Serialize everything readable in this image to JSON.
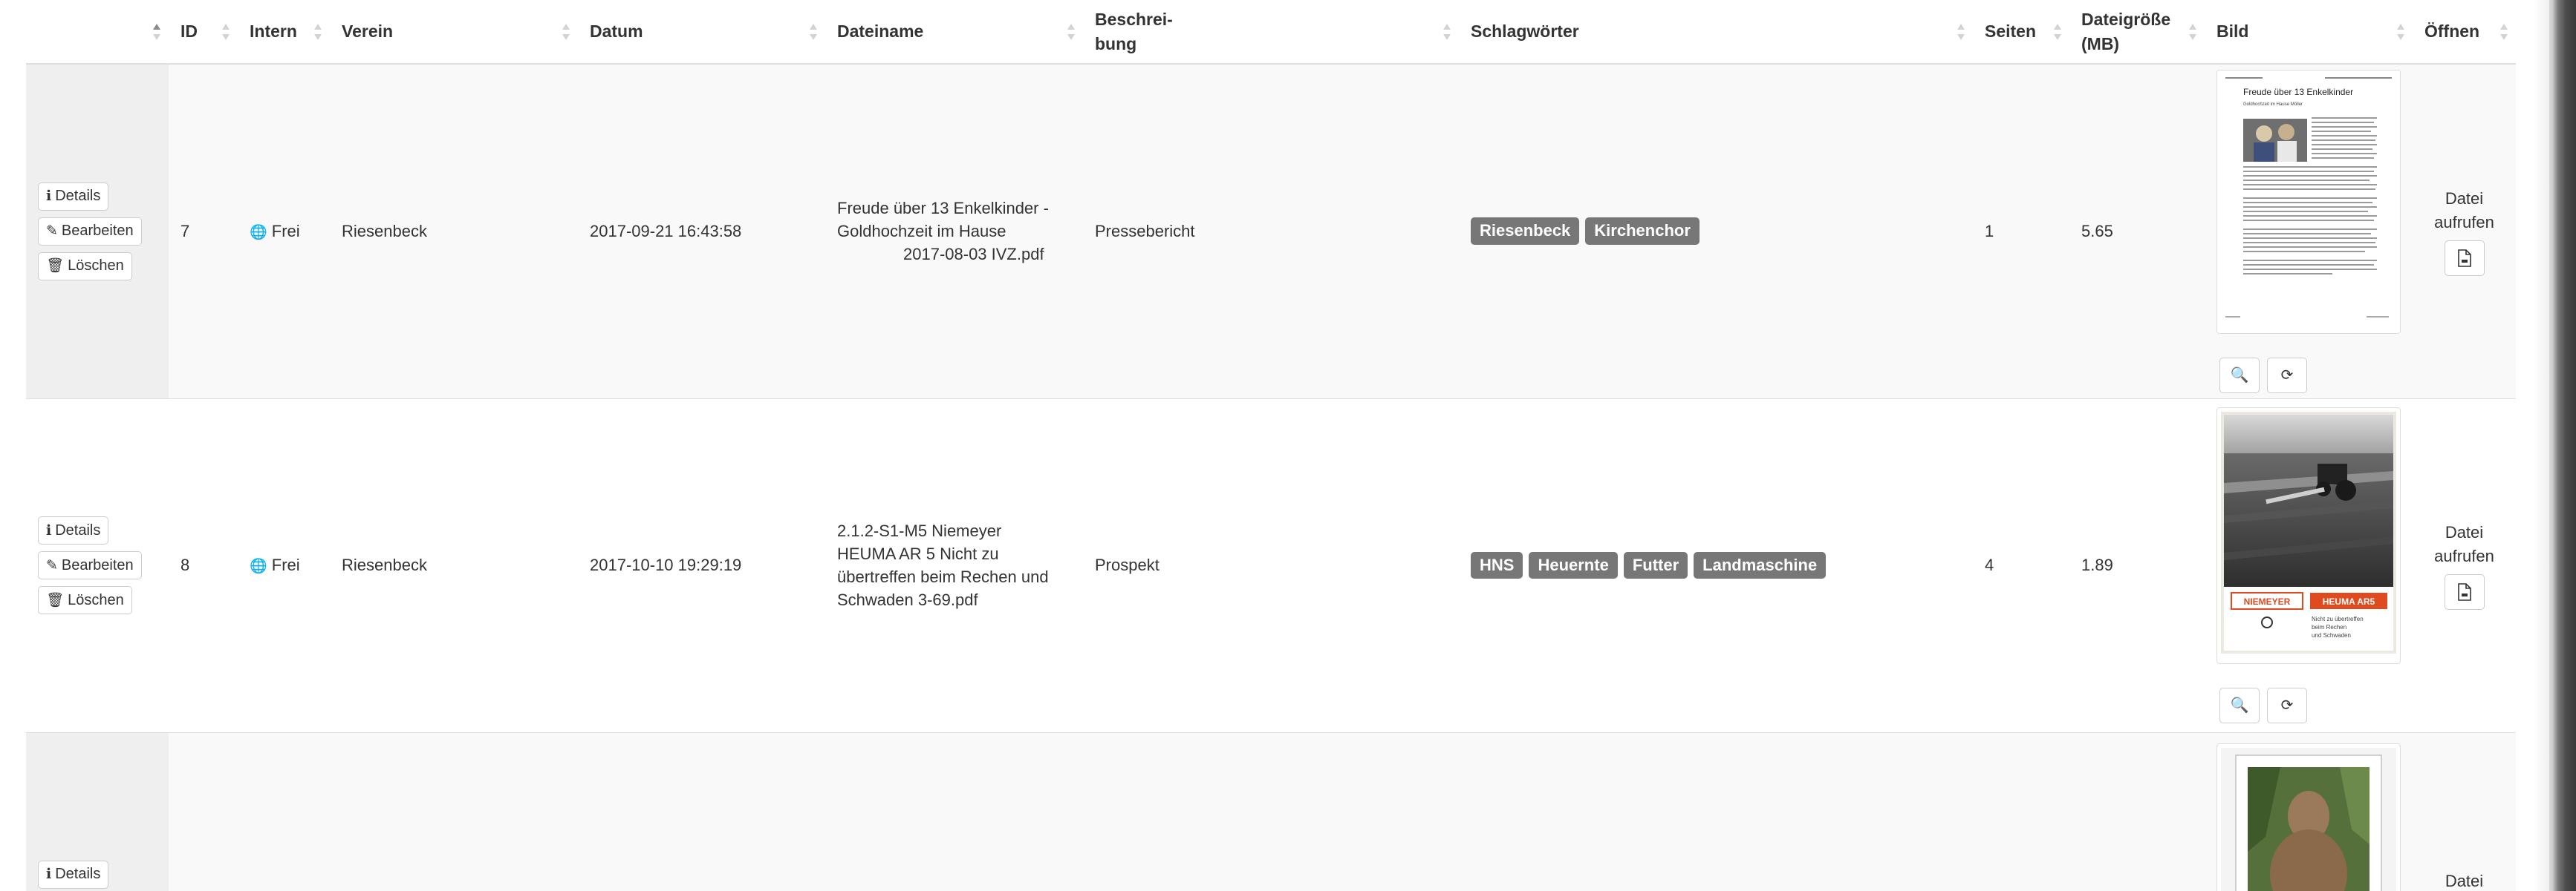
{
  "columns": {
    "id": "ID",
    "intern": "Intern",
    "verein": "Verein",
    "datum": "Datum",
    "dateiname": "Dateiname",
    "beschreibung_1": "Beschrei-",
    "beschreibung_2": "bung",
    "schlagwoerter": "Schlagwörter",
    "seiten": "Seiten",
    "dateigroesse_1": "Dateigröße",
    "dateigroesse_2": "(MB)",
    "bild": "Bild",
    "oeffnen": "Öffnen"
  },
  "actions": {
    "details": "Details",
    "edit": "Bearbeiten",
    "delete": "Löschen",
    "open_1": "Datei",
    "open_2": "aufrufen"
  },
  "rows": [
    {
      "id": "7",
      "intern": "Frei",
      "verein": "Riesenbeck",
      "datum": "2017-09-21 16:43:58",
      "filename_1": "Freude über 13 Enkelkinder -",
      "filename_2": "Goldhochzeit im Hause",
      "filename_3": "2017-08-03 IVZ.pdf",
      "beschreibung": "Pressebericht",
      "tags": [
        "Riesenbeck",
        "Kirchenchor"
      ],
      "seiten": "1",
      "groesse": "5.65",
      "thumb_title": "Freude über 13 Enkelkinder",
      "thumb_sub": "Goldhochzeit im Hause Möller"
    },
    {
      "id": "8",
      "intern": "Frei",
      "verein": "Riesenbeck",
      "datum": "2017-10-10 19:29:19",
      "filename_1": "2.1.2-S1-M5 Niemeyer",
      "filename_2": "HEUMA AR 5 Nicht zu",
      "filename_3": "übertreffen beim Rechen und",
      "filename_4": "Schwaden 3-69.pdf",
      "beschreibung": "Prospekt",
      "tags": [
        "HNS",
        "Heuernte",
        "Futter",
        "Landmaschine"
      ],
      "seiten": "4",
      "groesse": "1.89",
      "thumb_brand": "NIEMEYER",
      "thumb_model": "HEUMA AR5",
      "thumb_caption_1": "Nicht zu übertreffen",
      "thumb_caption_2": "beim Rechen",
      "thumb_caption_3": "und Schwaden"
    },
    {
      "id": "",
      "intern": "",
      "verein": ""
    }
  ]
}
